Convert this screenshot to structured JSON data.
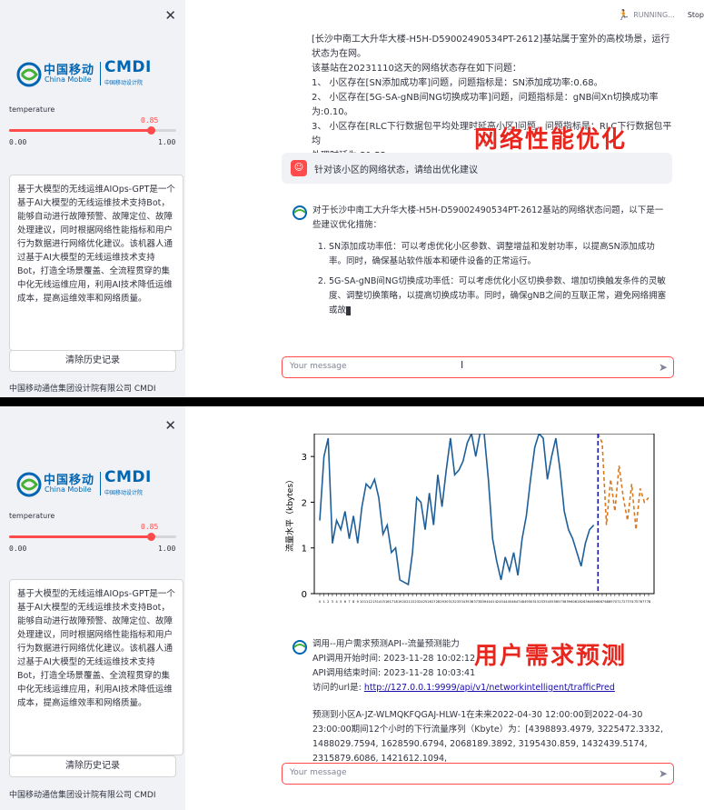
{
  "sidebar": {
    "close_icon": "close-icon",
    "logo": {
      "cn": "中国移动",
      "en": "China Mobile",
      "cmdi": "CMDI",
      "cmdi_sub": "中国移动设计院"
    },
    "slider": {
      "label": "temperature",
      "value": "0.85",
      "min": "0.00",
      "max": "1.00",
      "fraction": 0.85
    },
    "description": "基于大模型的无线运维AIOps-GPT是一个基于AI大模型的无线运维技术支持Bot，能够自动进行故障预警、故障定位、故障处理建议，同时根据网络性能指标和用户行为数据进行网络优化建议。该机器人通过基于AI大模型的无线运维技术支持Bot，打造全场景覆盖、全流程贯穿的集中化无线运维应用，利用AI技术降低运维成本，提高运维效率和网络质量。",
    "clear_button": "清除历史记录",
    "footer": "中国移动通信集团设计院有限公司 CMDI"
  },
  "status": {
    "running": "RUNNING...",
    "stop": "Stop"
  },
  "panel1": {
    "top_lines": [
      "[长沙中南工大升华大楼-H5H-D59002490534PT-2612]基站属于室外的高校场景，运行状态为在网。",
      "该基站在20231110这天的网络状态存在如下问题：",
      "1、   小区存在[SN添加成功率]问题，问题指标是：SN添加成功率:0.68。",
      "2、   小区存在[5G-SA-gNB间NG切换成功率]问题，问题指标是：gNB间Xn切换成功率为:0.10。",
      "3、   小区存在[RLC下行数据包平均处理时延高小区]问题，问题指标是：RLC下行数据包平均",
      "处理时延为:21.52。"
    ],
    "overlay_title": "网络性能优化",
    "user_message": "针对该小区的网络状态，请给出优化建议",
    "bot_intro": "对于长沙中南工大升华大楼-H5H-D59002490534PT-2612基站的网络状态问题，以下是一些建议优化措施：",
    "bot_items": [
      "SN添加成功率低：可以考虑优化小区参数、调整增益和发射功率，以提高SN添加成功率。同时，确保基站软件版本和硬件设备的正常运行。",
      "5G-SA-gNB间NG切换成功率低：可以考虑优化小区切换参数、增加切换触发条件的灵敏度、调整切换策略，以提高切换成功率。同时，确保gNB之间的互联正常，避免网络拥塞或故"
    ],
    "input_placeholder": "Your message"
  },
  "panel2": {
    "overlay_title": "用户需求预测",
    "api_lines": [
      "调用--用户需求预测API--流量预测能力",
      "API调用开始时间:   2023-11-28 10:02:12",
      "API调用结束时间:   2023-11-28 10:03:41"
    ],
    "url_label": "访问的url是:",
    "url": "http://127.0.0.1:9999/api/v1/networkintelligent/trafficPred",
    "prediction_text": "预测到小区A-JZ-WLMQKFQGAJ-HLW-1在未来2022-04-30 12:00:00到2022-04-30 23:00:00期间12个小时的下行流量序列（Kbyte）为：[4398893.4979, 3225472.3332, 1488029.7594, 1628590.6794, 2068189.3892, 3195430.859, 1432439.5174, 2315879.6086, 1421612.1094,",
    "input_placeholder": "Your message"
  },
  "chart_data": {
    "type": "line",
    "ylabel": "流量水平（kbytes）",
    "ylim": [
      0,
      3.5
    ],
    "yticks": [
      0,
      1,
      2,
      3
    ],
    "series": [
      {
        "values": [
          1.6,
          3.0,
          3.4,
          1.1,
          1.6,
          1.4,
          1.8,
          1.2,
          1.7,
          1.1,
          1.9,
          2.4,
          2.3,
          2.5,
          2.1,
          1.3,
          1.5,
          0.9,
          1.0,
          0.3,
          0.25,
          0.2,
          0.9,
          2.1,
          2.0,
          1.4,
          2.2,
          1.5,
          2.6,
          1.9,
          2.7,
          3.4,
          2.6,
          2.7,
          2.9,
          3.3,
          3.6,
          3.0,
          3.5,
          3.7,
          2.5,
          1.2,
          0.7,
          0.3,
          0.8,
          0.5,
          0.9,
          0.4,
          1.2,
          1.7,
          2.5,
          3.2,
          3.5,
          3.4,
          2.5,
          3.0,
          3.4,
          2.7,
          1.8,
          1.4,
          1.2,
          0.9,
          0.6,
          1.1,
          1.4,
          1.5
        ]
      },
      {
        "values": [
          3.5,
          3.3,
          1.5,
          2.5,
          1.8,
          2.8,
          2.1,
          1.6,
          2.4,
          1.4,
          2.3,
          2.0,
          2.1
        ],
        "dashed": true
      }
    ],
    "split_marker": true
  }
}
